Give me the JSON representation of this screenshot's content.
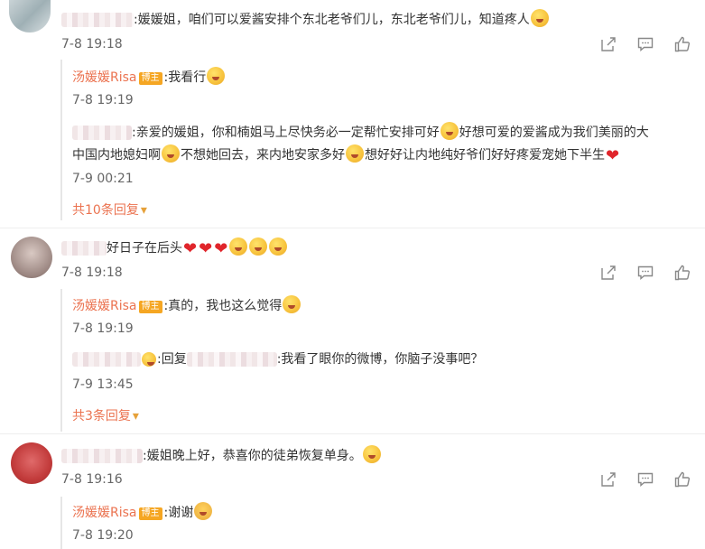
{
  "comments": [
    {
      "text": ":媛媛姐，咱们可以爱酱安排个东北老爷们儿，东北老爷们儿，知道疼人",
      "time": "7-8 19:18",
      "replies": [
        {
          "author": "汤媛媛Risa",
          "badge": "博主",
          "text": ":我看行",
          "time": "7-8 19:19"
        },
        {
          "text_a": ":亲爱的媛姐，你和楠姐马上尽快务必一定帮忙安排可好",
          "text_b": "好想可爱的爱酱成为我们美丽的大",
          "text_c": "中国内地媳妇啊",
          "text_d": "不想她回去，来内地安家多好",
          "text_e": "想好好让内地纯好爷们好好疼爱宠她下半生",
          "time": "7-9 00:21"
        }
      ],
      "more": "共10条回复"
    },
    {
      "text": "好日子在后头",
      "time": "7-8 19:18",
      "replies": [
        {
          "author": "汤媛媛Risa",
          "badge": "博主",
          "text": ":真的，我也这么觉得",
          "time": "7-8 19:19"
        },
        {
          "prefix": ":回复",
          "text": ":我看了眼你的微博，你脑子没事吧？",
          "time": "7-9 13:45"
        }
      ],
      "more": "共3条回复"
    },
    {
      "text": ":媛姐晚上好，恭喜你的徒弟恢复单身。",
      "time": "7-8 19:16",
      "replies": [
        {
          "author": "汤媛媛Risa",
          "badge": "博主",
          "text": ":谢谢",
          "time": "7-8 19:20"
        }
      ]
    }
  ],
  "icons": {
    "share": "share-icon",
    "comment": "comment-icon",
    "like": "like-icon",
    "more_arrow": "caret-down-icon"
  },
  "colors": {
    "accent": "#eb7350",
    "badge": "#f5a623",
    "heart": "#e0252b"
  }
}
